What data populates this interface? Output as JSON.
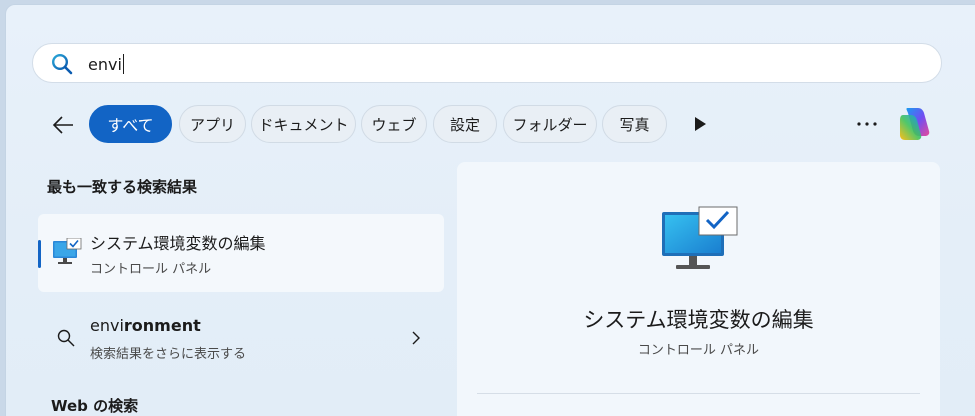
{
  "search": {
    "query": "envi"
  },
  "filters": [
    {
      "label": "すべて",
      "active": true
    },
    {
      "label": "アプリ"
    },
    {
      "label": "ドキュメント"
    },
    {
      "label": "ウェブ"
    },
    {
      "label": "設定"
    },
    {
      "label": "フォルダー"
    },
    {
      "label": "写真"
    }
  ],
  "icons": {
    "search": "search-icon",
    "back": "back-arrow-icon",
    "play": "play-icon",
    "more": "more-icon",
    "copilot": "copilot-icon"
  },
  "best_match": {
    "heading": "最も一致する検索結果",
    "title": "システム環境変数の編集",
    "subtitle": "コントロール パネル"
  },
  "suggestion": {
    "title_bold": "envi",
    "title_rest": "ronment",
    "subtitle": "検索結果をさらに表示する"
  },
  "web_heading": "Web の検索",
  "preview": {
    "title": "システム環境変数の編集",
    "subtitle": "コントロール パネル"
  },
  "colors": {
    "accent": "#1264c5"
  }
}
